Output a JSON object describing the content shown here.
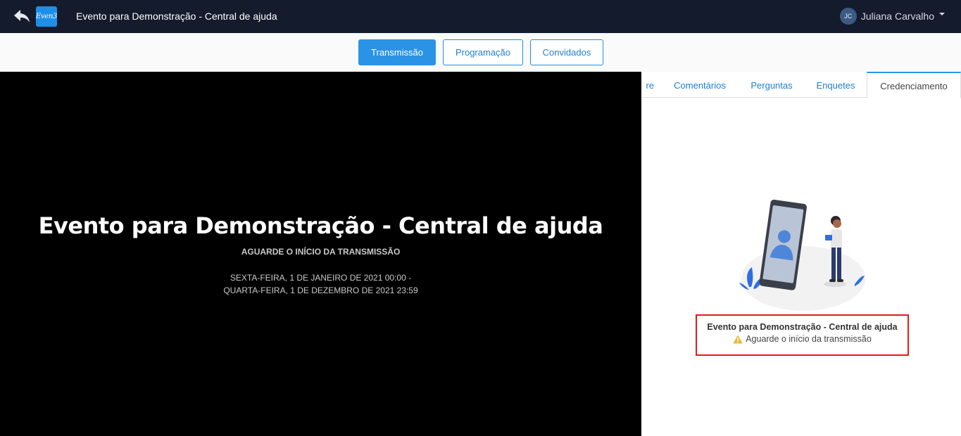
{
  "header": {
    "logo_text": "Even3",
    "title": "Evento para Demonstração - Central de ajuda",
    "user": {
      "initials": "JC",
      "name": "Juliana Carvalho"
    }
  },
  "nav": {
    "buttons": [
      {
        "label": "Transmissão",
        "active": true
      },
      {
        "label": "Programação",
        "active": false
      },
      {
        "label": "Convidados",
        "active": false
      }
    ]
  },
  "player": {
    "title": "Evento para Demonstração - Central de ajuda",
    "subtitle": "AGUARDE O INÍCIO DA TRANSMISSÃO",
    "date_start": "SEXTA-FEIRA, 1 DE JANEIRO DE 2021 00:00 -",
    "date_end": "QUARTA-FEIRA, 1 DE DEZEMBRO DE 2021 23:59"
  },
  "side": {
    "tabs": [
      {
        "label": "re",
        "active": false
      },
      {
        "label": "Comentários",
        "active": false
      },
      {
        "label": "Perguntas",
        "active": false
      },
      {
        "label": "Enquetes",
        "active": false
      },
      {
        "label": "Credenciamento",
        "active": true
      }
    ],
    "event_title": "Evento para Demonstração - Central de ajuda",
    "status_text": "Aguarde o início da transmissão",
    "status_icon": "warning-icon"
  },
  "colors": {
    "topbar": "#141b2d",
    "accent": "#2b93e6",
    "highlight_border": "#e41a1a",
    "warning": "#f0b429"
  }
}
